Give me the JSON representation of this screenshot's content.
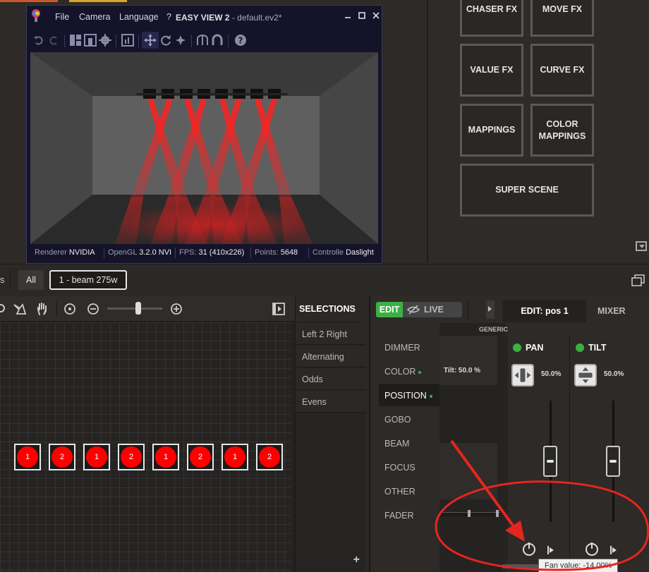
{
  "easyview": {
    "menu": [
      "File",
      "Camera",
      "Language",
      "?"
    ],
    "title_app": "EASY VIEW 2",
    "title_file": " - default.ev2*",
    "status": {
      "renderer_label": "Renderer",
      "renderer_value": "NVIDIA",
      "opengl_label": "OpenGL",
      "opengl_value": "3.2.0 NVI",
      "fps_label": "FPS:",
      "fps_value": "31 (410x226)",
      "points_label": "Points:",
      "points_value": "5648",
      "controller_label": "Controlle",
      "controller_value": "Daslight"
    }
  },
  "fx_buttons": [
    "CHASER FX",
    "MOVE FX",
    "VALUE FX",
    "CURVE FX",
    "MAPPINGS",
    "COLOR MAPPINGS",
    "SUPER SCENE"
  ],
  "group_bar": {
    "prefix": "s",
    "all": "All",
    "group": "1 - beam 275w"
  },
  "fixtures": [
    "1",
    "2",
    "1",
    "2",
    "1",
    "2",
    "1",
    "2"
  ],
  "selections": {
    "title": "SELECTIONS",
    "items": [
      "Left 2 Right",
      "Alternating",
      "Odds",
      "Evens"
    ],
    "add": "+"
  },
  "editor": {
    "edit": "EDIT",
    "live": "LIVE",
    "tab_edit": "EDIT: pos 1",
    "tab_mixer": "MIXER",
    "generic": "GENERIC",
    "tilt_readout": "Tilt: 50.0 %",
    "categories": [
      "DIMMER",
      "COLOR",
      "POSITION",
      "GOBO",
      "BEAM",
      "FOCUS",
      "OTHER",
      "FADER"
    ],
    "channels": [
      {
        "name": "PAN",
        "value": "50.0%"
      },
      {
        "name": "TILT",
        "value": "50.0%"
      }
    ],
    "tooltip": "Fan value: -14.00%"
  },
  "colors": {
    "accent_green": "#3cb043",
    "fixture_red": "#ff0000",
    "annotation_red": "#e8241e"
  }
}
